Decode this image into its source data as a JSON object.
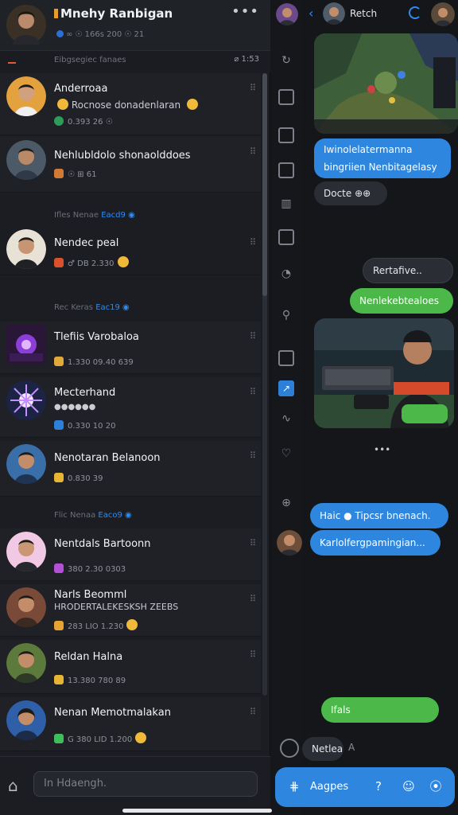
{
  "left_header": {
    "title": "Mnehy Ranbigan",
    "subtitle": "∞ ☉ 166s 200 ☉ 21",
    "more": "•••"
  },
  "filter": {
    "text": "Eibgsegiec fanaes",
    "right": "⌀  1:53"
  },
  "conversations": [
    {
      "name": "Anderroaa",
      "preview": "Rocnose donadenlaran",
      "meta": "0.393   26   ☉"
    },
    {
      "name": "Nehlubldolo shonaolddoes",
      "preview": "",
      "meta": "☉   ⊞   61"
    },
    {
      "name": "Nendec peal",
      "preview": "",
      "meta": "♂   DB   2.330"
    },
    {
      "name": "Tlefiis Varobaloa",
      "preview": "",
      "meta": "1.330   09.40   639"
    },
    {
      "name": "Mecterhand",
      "preview": "",
      "meta": "0.330   10   20"
    },
    {
      "name": "Nenotaran Belanoon",
      "preview": "",
      "meta": "0.830   39"
    },
    {
      "name": "Nentdals Bartoonn",
      "preview": "",
      "meta": "380   2.30   0303"
    },
    {
      "name": "Narls Beomml",
      "preview": "HRODERTALEKESKSH ZEEBS",
      "meta": "283   LIO   1.230"
    },
    {
      "name": "Reldan Halna",
      "preview": "",
      "meta": "13.380   780   89"
    },
    {
      "name": "Nenan Memotmalakan",
      "preview": "",
      "meta": "G 380   LID   1.200"
    }
  ],
  "separators": [
    {
      "label": "Ifles Nenae",
      "badge": "Eacd9"
    },
    {
      "label": "Rec Keras",
      "badge": "Eac19"
    },
    {
      "label": "Flic Nenaa",
      "badge": "Eaco9"
    }
  ],
  "left_input": {
    "placeholder": "In Hdaengh."
  },
  "chat_header": {
    "name": "Retch"
  },
  "messages": [
    {
      "side": "out",
      "text1": "Iwinolelatermanna",
      "text2": "bingriien Nenbitagelasy"
    },
    {
      "side": "in",
      "text": "Docte ⊕⊕"
    },
    {
      "side": "out",
      "text": "Rertafive.."
    },
    {
      "side": "out",
      "text": "Nenlekebtealoes"
    },
    {
      "side": "in",
      "text": "Haic ● Tipcsr bnenach."
    },
    {
      "side": "in",
      "text": "Karlolfergpamingian..."
    },
    {
      "side": "out",
      "text": "Ifals"
    },
    {
      "side": "in",
      "text": "Netlea"
    }
  ],
  "composer": {
    "label": "Aagpes"
  },
  "colors": {
    "accent": "#2e86de",
    "outgoing_green": "#4cb84a",
    "panel": "#1f2126",
    "background": "#14161a"
  },
  "icons": [
    "more-icon",
    "back-icon",
    "sync-icon",
    "home-icon",
    "grid-icon",
    "help-icon",
    "smile-icon",
    "mic-icon"
  ]
}
